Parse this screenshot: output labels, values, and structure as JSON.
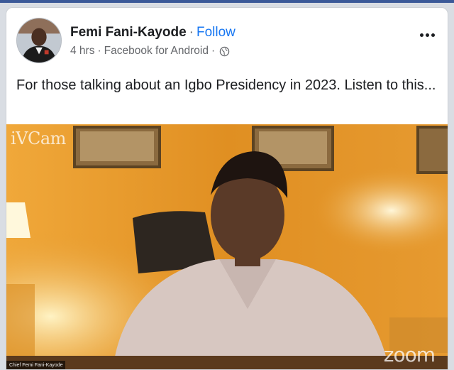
{
  "post": {
    "author": "Femi Fani-Kayode",
    "separator": "·",
    "follow_label": "Follow",
    "time": "4 hrs",
    "source": "Facebook for Android",
    "visibility_icon": "globe-icon",
    "more_icon": "more-options-icon",
    "caption": "For those talking about an Igbo Presidency in 2023. Listen to this..."
  },
  "video": {
    "watermark_left": "iVCam",
    "watermark_right": "zoom",
    "name_tag": "Chief Femi Fani-Kayode"
  },
  "colors": {
    "brand": "#3b5998",
    "link": "#1877f2",
    "wall": "#e59a2b"
  }
}
